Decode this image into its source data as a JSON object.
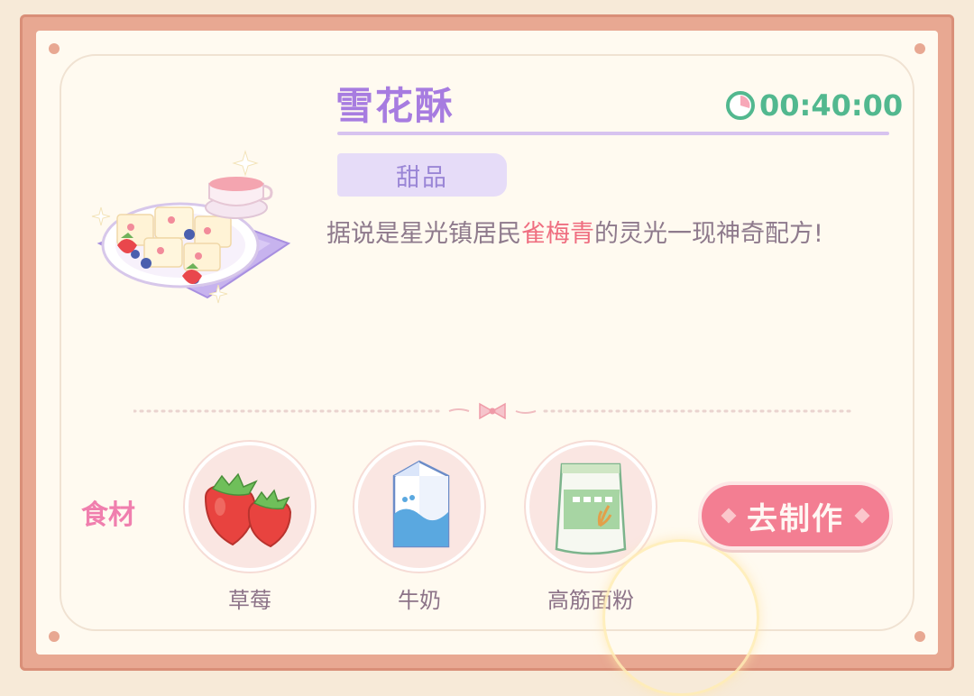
{
  "recipe": {
    "title": "雪花酥",
    "timer": "00:40:00",
    "category": "甜品",
    "description_before": "据说是星光镇居民",
    "description_highlight": "雀梅青",
    "description_after": "的灵光一现神奇配方!"
  },
  "ingredients": {
    "label": "食材",
    "items": [
      {
        "name": "草莓",
        "icon": "strawberry-icon"
      },
      {
        "name": "牛奶",
        "icon": "milk-carton-icon"
      },
      {
        "name": "高筋面粉",
        "icon": "flour-bag-icon"
      }
    ]
  },
  "actions": {
    "make_label": "去制作"
  },
  "colors": {
    "title": "#a77ce0",
    "timer": "#52b88f",
    "highlight": "#ef6e80",
    "button": "#f37e92",
    "frame": "#e8a892"
  }
}
